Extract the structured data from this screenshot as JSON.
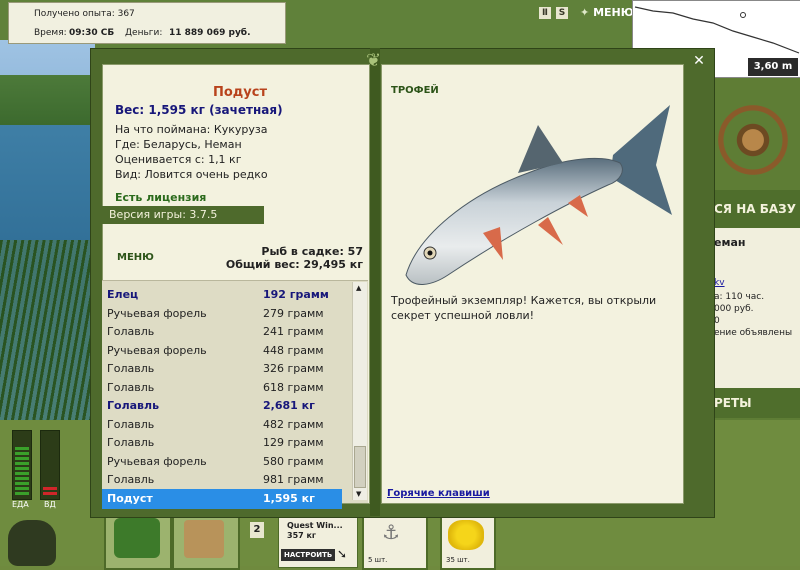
{
  "status": {
    "experience": "Получено опыта: 367",
    "time_label": "Время:",
    "time_value": "09:30 СБ",
    "money_label": "Деньги:",
    "money_value": "11 889 069 руб."
  },
  "top": {
    "pause_icon": "pause-icon",
    "s_label": "S",
    "menu_label": "МЕНЮ",
    "depth": "3,60 m"
  },
  "fish_detail": {
    "name": "Подуст",
    "weight": "Вес: 1,595 кг (зачетная)",
    "caught_on": "На что поймана: Кукуруза",
    "where": "Где: Беларусь, Неман",
    "valued_from": "Оценивается с: 1,1 кг",
    "kind": "Вид: Ловится очень редко",
    "license": "Есть лицензия",
    "version": "Версия игры: 3.7.5",
    "menu": "МЕНЮ",
    "fish_count": "Рыб в садке: 57",
    "total_weight": "Общий вес: 29,495 кг"
  },
  "catch_list": [
    {
      "name": "Елец",
      "weight": "192 грамм",
      "style": "bold"
    },
    {
      "name": "Ручьевая форель",
      "weight": "279 грамм",
      "style": "normal"
    },
    {
      "name": "Голавль",
      "weight": "241 грамм",
      "style": "normal"
    },
    {
      "name": "Ручьевая форель",
      "weight": "448 грамм",
      "style": "normal"
    },
    {
      "name": "Голавль",
      "weight": "326 грамм",
      "style": "normal"
    },
    {
      "name": "Голавль",
      "weight": "618 грамм",
      "style": "normal"
    },
    {
      "name": "Голавль",
      "weight": "2,681 кг",
      "style": "bold"
    },
    {
      "name": "Голавль",
      "weight": "482 грамм",
      "style": "normal"
    },
    {
      "name": "Голавль",
      "weight": "129 грамм",
      "style": "normal"
    },
    {
      "name": "Ручьевая форель",
      "weight": "580 грамм",
      "style": "normal"
    },
    {
      "name": "Голавль",
      "weight": "981 грамм",
      "style": "normal"
    },
    {
      "name": "Подуст",
      "weight": "1,595 кг",
      "style": "selected"
    }
  ],
  "trophy": {
    "label": "ТРОФЕЙ",
    "description": "Трофейный экземпляр! Кажется, вы открыли секрет успешной ловли!",
    "hotkeys": "Горячие клавиши"
  },
  "right_panel": {
    "base_button": "СЯ НА БАЗУ",
    "location": "еман",
    "link": "kv",
    "line1": "а: 110 час.",
    "line2": "000 руб.",
    "line3": "0",
    "line4": "ение объявлены",
    "secrets": "РЕТЫ"
  },
  "bottom": {
    "food_label": "ЕДА",
    "ed_label": "ВД",
    "slot_number": "2",
    "quest_title": "Quest Win...",
    "quest_price": "357 кг",
    "setup_button": "НАСТРОИТЬ",
    "item1_count": "5 шт.",
    "item2_count": "35 шт."
  },
  "colors": {
    "panel_green": "#4e6a2c",
    "title_orange": "#b8431c",
    "weight_navy": "#17177a",
    "selected_blue": "#2a8ee6"
  }
}
